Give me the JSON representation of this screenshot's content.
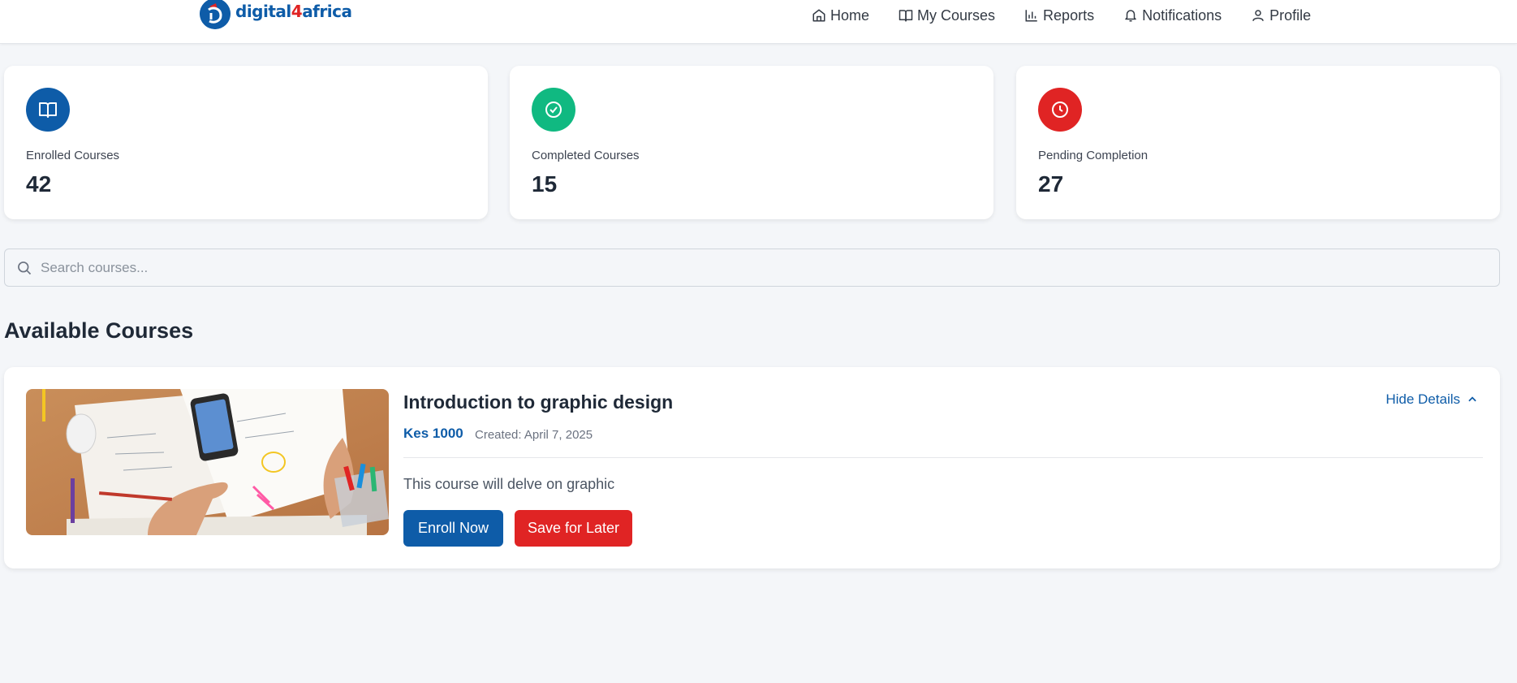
{
  "header": {
    "logo_text_a": "digital",
    "logo_text_b": "4",
    "logo_text_c": "africa",
    "nav": [
      {
        "label": "Home",
        "icon": "home-icon"
      },
      {
        "label": "My Courses",
        "icon": "book-open-icon"
      },
      {
        "label": "Reports",
        "icon": "bar-chart-icon"
      },
      {
        "label": "Notifications",
        "icon": "bell-icon"
      },
      {
        "label": "Profile",
        "icon": "user-icon"
      }
    ]
  },
  "stats": [
    {
      "label": "Enrolled Courses",
      "value": "42",
      "icon": "book-icon",
      "color": "#0e5ca8"
    },
    {
      "label": "Completed Courses",
      "value": "15",
      "icon": "check-circle-icon",
      "color": "#10b981"
    },
    {
      "label": "Pending Completion",
      "value": "27",
      "icon": "clock-icon",
      "color": "#e02424"
    }
  ],
  "search": {
    "placeholder": "Search courses..."
  },
  "section_title": "Available Courses",
  "course": {
    "title": "Introduction to graphic design",
    "price": "Kes 1000",
    "created": "Created: April 7, 2025",
    "description": "This course will delve on graphic",
    "enroll_label": "Enroll Now",
    "save_label": "Save for Later",
    "toggle_label": "Hide Details"
  },
  "colors": {
    "primary": "#0e5ca8",
    "danger": "#e02424",
    "success": "#10b981",
    "background": "#f4f6f9"
  }
}
